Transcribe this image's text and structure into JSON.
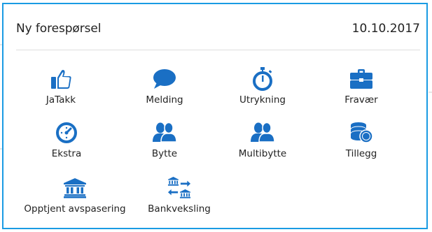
{
  "dialog": {
    "title": "Ny forespørsel",
    "date": "10.10.2017"
  },
  "accent_color": "#1a6fc4",
  "border_color": "#1a9be3",
  "options": [
    {
      "label": "JaTakk",
      "icon": "thumbs-up-icon"
    },
    {
      "label": "Melding",
      "icon": "speech-bubble-icon"
    },
    {
      "label": "Utrykning",
      "icon": "stopwatch-icon"
    },
    {
      "label": "Fravær",
      "icon": "briefcase-icon"
    },
    {
      "label": "Ekstra",
      "icon": "clock-icon"
    },
    {
      "label": "Bytte",
      "icon": "users-icon"
    },
    {
      "label": "Multibytte",
      "icon": "users-icon"
    },
    {
      "label": "Tillegg",
      "icon": "coins-icon"
    },
    {
      "label": "Opptjent avspasering",
      "icon": "bank-icon"
    },
    {
      "label": "Bankveksling",
      "icon": "bank-exchange-icon"
    }
  ]
}
